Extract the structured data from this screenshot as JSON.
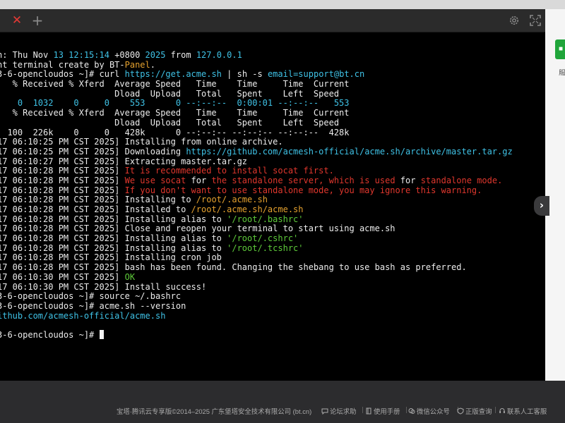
{
  "tabbar": {
    "close_glyph": "✕",
    "add_glyph": "+",
    "icons": [
      "close-icon",
      "plus-icon",
      "gear-icon",
      "fullscreen-icon"
    ]
  },
  "colors": {
    "terminal_bg": "#000000",
    "text": "#d8d8d8",
    "cyan": "#3fc2e6",
    "orange": "#e5a12e",
    "red": "#e0372d",
    "green": "#5ecb3a",
    "brand_green": "#20a53a"
  },
  "terminal": {
    "lines": [
      [
        [
          "n: Thu Nov ",
          "white"
        ],
        [
          "13 12:15:14",
          "cyan"
        ],
        [
          " +0800 ",
          "white"
        ],
        [
          "2025",
          "cyan"
        ],
        [
          " from ",
          "white"
        ],
        [
          "127.0.0.1",
          "cyan"
        ]
      ],
      [
        [
          "nt terminal create by BT-",
          "white"
        ],
        [
          "Panel",
          "orange"
        ],
        [
          ".",
          "white"
        ]
      ],
      [
        [
          "3-6-opencloudos ~]# ",
          "white"
        ],
        [
          "curl ",
          "white"
        ],
        [
          "https://get.acme.sh",
          "cyan"
        ],
        [
          " | ",
          "white"
        ],
        [
          "sh",
          "white"
        ],
        [
          " -s ",
          "white"
        ],
        [
          "email=support@bt.cn",
          "cyan"
        ]
      ],
      [
        [
          "   % Received % Xferd  Average Speed   Time    Time     Time  Current",
          "white"
        ]
      ],
      [
        [
          "                       Dload  Upload   Total   Spent    Left  Speed",
          "white"
        ]
      ],
      [
        [
          "    0  1032    0     0    553      0 --:--:--  0:00:01 --:--:--   553",
          "cyan"
        ]
      ],
      [
        [
          "   % Received % Xferd  Average Speed   Time    Time     Time  Current",
          "white"
        ]
      ],
      [
        [
          "                       Dload  Upload   Total   Spent    Left  Speed",
          "white"
        ]
      ],
      [
        [
          "  100  226k    0     0   428k      0 --:--:-- --:--:-- --:--:--  428k",
          "white"
        ]
      ],
      [
        [
          "17 06:10:25 PM CST 2025] ",
          "white"
        ],
        [
          "Installing from online archive.",
          "white"
        ]
      ],
      [
        [
          "17 06:10:25 PM CST 2025] ",
          "white"
        ],
        [
          "Downloading ",
          "white"
        ],
        [
          "https://github.com/acmesh-official/acme.sh/archive/master.tar.gz",
          "cyan"
        ]
      ],
      [
        [
          "17 06:10:27 PM CST 2025] ",
          "white"
        ],
        [
          "Extracting master.tar.gz",
          "white"
        ]
      ],
      [
        [
          "17 06:10:28 PM CST 2025] ",
          "white"
        ],
        [
          "It is recommended to install socat first.",
          "red"
        ]
      ],
      [
        [
          "17 06:10:28 PM CST 2025] ",
          "white"
        ],
        [
          "We use socat ",
          "red"
        ],
        [
          "for",
          "white"
        ],
        [
          " the standalone server, which is used ",
          "red"
        ],
        [
          "for",
          "white"
        ],
        [
          " standalone mode.",
          "red"
        ]
      ],
      [
        [
          "17 06:10:28 PM CST 2025] ",
          "white"
        ],
        [
          "If you don't want to use standalone mode, you may ignore this warning.",
          "red"
        ]
      ],
      [
        [
          "17 06:10:28 PM CST 2025] ",
          "white"
        ],
        [
          "Installing to ",
          "white"
        ],
        [
          "/root/.acme.sh",
          "orange"
        ]
      ],
      [
        [
          "17 06:10:28 PM CST 2025] ",
          "white"
        ],
        [
          "Installed to ",
          "white"
        ],
        [
          "/root/.acme.sh/acme.sh",
          "orange"
        ]
      ],
      [
        [
          "17 06:10:28 PM CST 2025] ",
          "white"
        ],
        [
          "Installing alias to ",
          "white"
        ],
        [
          "'/root/.bashrc'",
          "green"
        ]
      ],
      [
        [
          "17 06:10:28 PM CST 2025] ",
          "white"
        ],
        [
          "Close and reopen your terminal to start using acme.sh",
          "white"
        ]
      ],
      [
        [
          "17 06:10:28 PM CST 2025] ",
          "white"
        ],
        [
          "Installing alias to ",
          "white"
        ],
        [
          "'/root/.cshrc'",
          "green"
        ]
      ],
      [
        [
          "17 06:10:28 PM CST 2025] ",
          "white"
        ],
        [
          "Installing alias to ",
          "white"
        ],
        [
          "'/root/.tcshrc'",
          "green"
        ]
      ],
      [
        [
          "17 06:10:28 PM CST 2025] ",
          "white"
        ],
        [
          "Installing cron job",
          "white"
        ]
      ],
      [
        [
          "17 06:10:28 PM CST 2025] ",
          "white"
        ],
        [
          "bash has been found. Changing the shebang to use bash as preferred.",
          "white"
        ]
      ],
      [
        [
          "17 06:10:30 PM CST 2025] ",
          "white"
        ],
        [
          "OK",
          "green"
        ]
      ],
      [
        [
          "17 06:10:30 PM CST 2025] ",
          "white"
        ],
        [
          "Install success!",
          "white"
        ]
      ],
      [
        [
          "3-6-opencloudos ~]# ",
          "white"
        ],
        [
          "source ~/.bashrc",
          "white"
        ]
      ],
      [
        [
          "3-6-opencloudos ~]# ",
          "white"
        ],
        [
          "acme.sh --version",
          "white"
        ]
      ],
      [
        [
          "ithub.com/acmesh-official/acme.sh",
          "cyan"
        ]
      ],
      [
        [
          "",
          "white"
        ]
      ],
      [
        [
          "3-6-opencloudos ~]# ",
          "white"
        ]
      ]
    ]
  },
  "right_panel": {
    "button_text": "■",
    "label_text": "服"
  },
  "expand_handle": {
    "glyph": "›"
  },
  "footer": {
    "copyright": "宝塔·腾讯云专享版©2014–2025 广东堡塔安全技术有限公司 (bt.cn)",
    "links": [
      {
        "label": "论坛求助",
        "icon": "chat-icon"
      },
      {
        "label": "使用手册",
        "icon": "book-icon"
      },
      {
        "label": "微信公众号",
        "icon": "wechat-icon"
      },
      {
        "label": "正版查询",
        "icon": "shield-icon"
      },
      {
        "label": "联系人工客服",
        "icon": "support-icon"
      }
    ]
  }
}
